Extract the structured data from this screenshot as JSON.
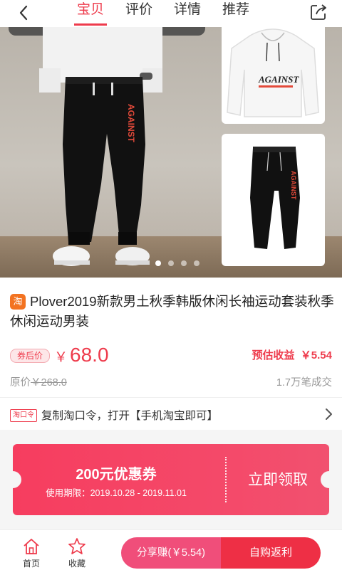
{
  "nav": {
    "tabs": [
      {
        "label": "宝贝"
      },
      {
        "label": "评价"
      },
      {
        "label": "详情"
      },
      {
        "label": "推荐"
      }
    ]
  },
  "gallery": {
    "dots": 4,
    "active_dot": 1,
    "shirt_print": "AGAINST",
    "pants_print": "AGAINST"
  },
  "product": {
    "platform_badge": "淘",
    "title": "Plover2019新款男土秋季韩版休闲长袖运动套装秋季休闲运动男装",
    "coupon_tag": "券后价",
    "currency": "￥",
    "price": "68.0",
    "estimated_label": "预估收益",
    "estimated_value": "￥5.54",
    "original_label": "原价",
    "original_price": "￥268.0",
    "sales": "1.7万笔成交"
  },
  "copy": {
    "tag": "淘口令",
    "text": "复制淘口令，打开【手机淘宝即可】"
  },
  "coupon": {
    "amount": "200元优惠券",
    "period": "使用期限：2019.10.28 - 2019.11.01",
    "action": "立即领取"
  },
  "bottom": {
    "home": "首页",
    "favorite": "收藏",
    "share": "分享赚(￥5.54)",
    "buy": "自购返利"
  },
  "colors": {
    "accent": "#ee3b4c",
    "coupon": "#f63d5f",
    "share_button": "#f04e7a",
    "buy_button": "#ee2f45"
  }
}
